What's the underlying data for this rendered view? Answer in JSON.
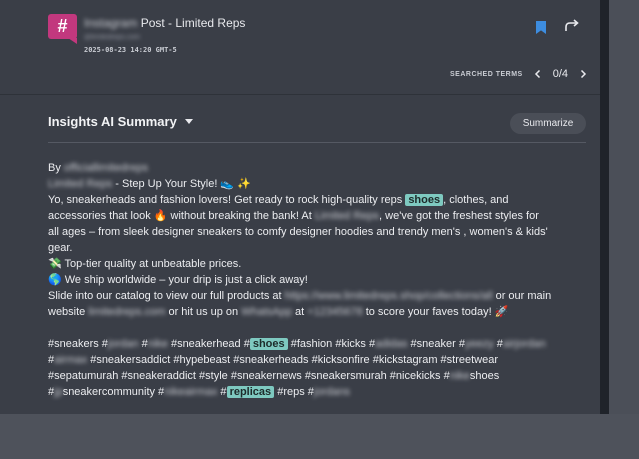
{
  "post": {
    "platform": "Instagram",
    "title_suffix": "Post - Limited Reps",
    "handle": "@limitedreps.com",
    "timestamp": "2025-08-23 14:20 GMT-5"
  },
  "search_terms": {
    "label": "SEARCHED TERMS",
    "counter": "0/4"
  },
  "summary": {
    "title": "Insights AI Summary",
    "button": "Summarize"
  },
  "body": {
    "by": "By",
    "author": "officiallimitedreps",
    "l2_blur": "Limited Reps",
    "l2_text": " - Step Up Your Style! 👟 ✨",
    "l3_a": "Yo, sneakerheads and fashion lovers! Get ready to rock high-quality reps ",
    "hl_shoes": "shoes",
    "l3_b": ", clothes, and",
    "l4_a": "accessories that look 🔥 without breaking the bank! At ",
    "l4_blur": "Limited Reps",
    "l4_b": ", we've got the freshest styles for",
    "l5": "all ages – from sleek designer sneakers to comfy designer hoodies and trendy men's , women's & kids'",
    "l6": "gear.",
    "l7": "💸 Top-tier quality at unbeatable prices.",
    "l8": "🌎 We ship worldwide – your drip is just a click away!",
    "l9_a": "Slide into our catalog to view our full products at ",
    "l9_blur": "https://www.limitedreps.shop/collections/all",
    "l9_b": " or our main",
    "l10_a": "website ",
    "l10_blur1": "limitedreps.com",
    "l10_b": " or hit us up on ",
    "l10_blur2": "WhatsApp",
    "l10_c": " at ",
    "l10_blur3": "+12345678",
    "l10_d": " to score your faves today! 🚀",
    "h1_a": "#sneakers #",
    "h1_b1": "jordan",
    "h1_c": " #",
    "h1_b2": "nike",
    "h1_d": " #sneakerhead #",
    "hl_shoes2": "shoes",
    "h1_e": " #fashion #kicks #",
    "h1_b3": "adidas",
    "h1_f": " #sneaker #",
    "h1_b4": "yeezy",
    "h1_g": " #",
    "h1_b5": "airjordan",
    "h2_a": "#",
    "h2_b1": "airmax",
    "h2_c": " #sneakersaddict #hypebeast #sneakerheads #kicksonfire #kickstagram #streetwear",
    "h3_a": "#sepatumurah #sneakeraddict #style #sneakernews #sneakersmurah #nicekicks #",
    "h3_b1": "nike",
    "h3_c": "shoes",
    "h4_a": "#",
    "h4_b1": "jp",
    "h4_c": "sneakercommunity #",
    "h4_b2": "nikeairmax",
    "h4_d": " #",
    "hl_replicas": "replicas",
    "h4_e": " #reps #",
    "h4_b3": "jordans"
  },
  "colors": {
    "accent_pink": "#c2387e",
    "bookmark_blue": "#3d8de0",
    "highlight": "#7ec9c0"
  }
}
